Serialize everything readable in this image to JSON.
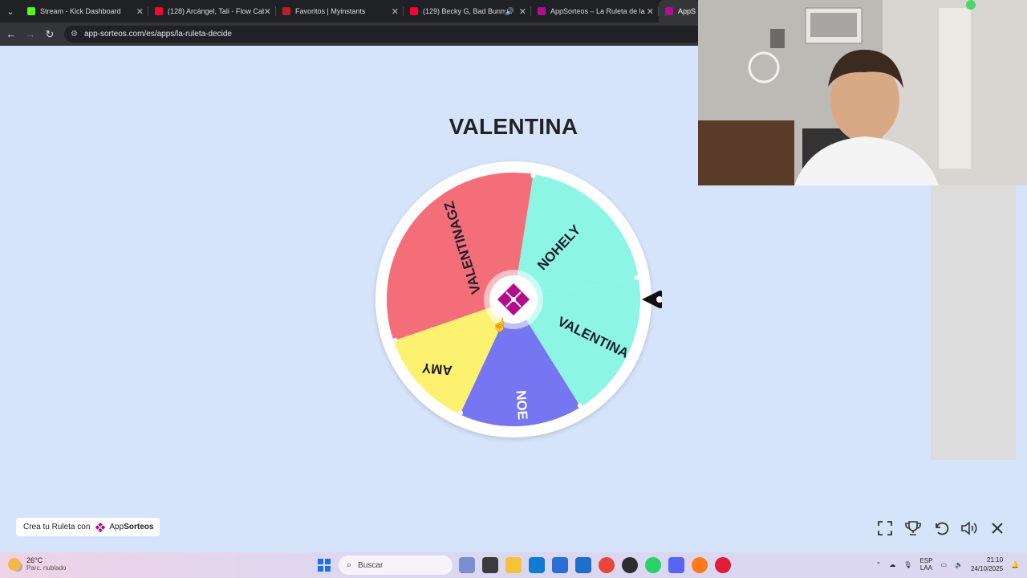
{
  "browser": {
    "tabs": [
      {
        "title": "Stream - Kick Dashboard",
        "favicon_color": "#53fc18",
        "active": false,
        "audio": false
      },
      {
        "title": "(128) Arcángel, Tali - Flow Cabr",
        "favicon_color": "#ff0033",
        "active": false,
        "audio": false
      },
      {
        "title": "Favoritos | Myinstants",
        "favicon_color": "#b5202a",
        "active": false,
        "audio": false
      },
      {
        "title": "(129) Becky G, Bad Bunny -",
        "favicon_color": "#ff0033",
        "active": false,
        "audio": true
      },
      {
        "title": "AppSorteos – La Ruleta de la S",
        "favicon_color": "#b40c8c",
        "active": false,
        "audio": false
      },
      {
        "title": "AppSorte",
        "favicon_color": "#b40c8c",
        "active": true,
        "audio": false
      }
    ],
    "url": "app-sorteos.com/es/apps/la-ruleta-decide"
  },
  "page": {
    "winner": "VALENTINA",
    "wheel": {
      "segments": [
        {
          "label": "NOHELY",
          "color": "#8cf5e3"
        },
        {
          "label": "VALENTINA",
          "color": "#8cf5e3"
        },
        {
          "label": "NOE",
          "color": "#7676f2"
        },
        {
          "label": "AMY",
          "color": "#fdf26f"
        },
        {
          "label": "VALENTINAGZ",
          "color": "#f36e78"
        }
      ],
      "pointer_color": "#111111",
      "rim_color": "#ffffff"
    },
    "brand": {
      "prefix": "Crea tu Ruleta con",
      "name_a": "App",
      "name_b": "Sorteos"
    },
    "controls": [
      "fullscreen-icon",
      "trophy-icon",
      "reset-icon",
      "volume-icon",
      "close-icon"
    ]
  },
  "taskbar": {
    "weather_temp": "26°C",
    "weather_desc": "Parc. nublado",
    "search_placeholder": "Buscar",
    "lang_1": "ESP",
    "lang_2": "LAA",
    "time": "21:10",
    "date": "24/10/2025",
    "apps": [
      "news-widget-icon",
      "terminal-icon",
      "file-explorer-icon",
      "edge-icon",
      "store-icon",
      "outlook-icon",
      "chrome-icon",
      "obs-icon",
      "whatsapp-icon",
      "discord-icon",
      "firefox-icon",
      "opera-icon"
    ],
    "app_colors": [
      "#7a8fd0",
      "#3b3b3b",
      "#f3c33a",
      "#0f7bd1",
      "#2a6fd6",
      "#1d6fc9",
      "#e9453b",
      "#2d2d2d",
      "#25d366",
      "#5865f2",
      "#ff7a1a",
      "#e21b36"
    ]
  }
}
